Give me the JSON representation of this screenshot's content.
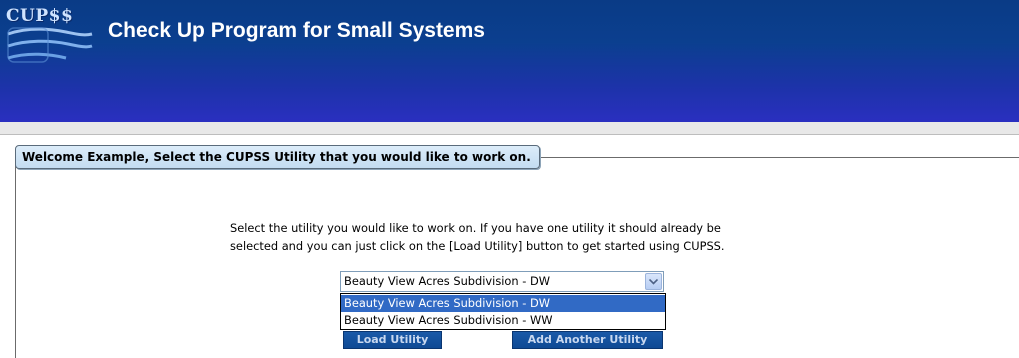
{
  "header": {
    "logo_text": "CUP$$",
    "title": "Check Up Program for Small Systems"
  },
  "panel": {
    "tab_label": "Welcome Example, Select the CUPSS Utility that you would like to work on.",
    "instructions_line1": "Select the utility you would like to work on. If you have one utility it should already be",
    "instructions_line2": "selected and you can just click on the [Load Utility] button to get started using CUPSS."
  },
  "utility_select": {
    "selected_value": "Beauty View Acres Subdivision - DW",
    "options": [
      {
        "label": "Beauty View Acres Subdivision - DW",
        "highlighted": true
      },
      {
        "label": "Beauty View Acres Subdivision - WW",
        "highlighted": false
      }
    ]
  },
  "buttons": {
    "load_utility_label": "Load Utility",
    "add_another_utility_label": "Add Another Utility"
  },
  "colors": {
    "header_top": "#0a3b86",
    "header_bottom": "#2a2fc0",
    "selection_highlight": "#316ac5",
    "button_blue": "#1a5aa8"
  }
}
